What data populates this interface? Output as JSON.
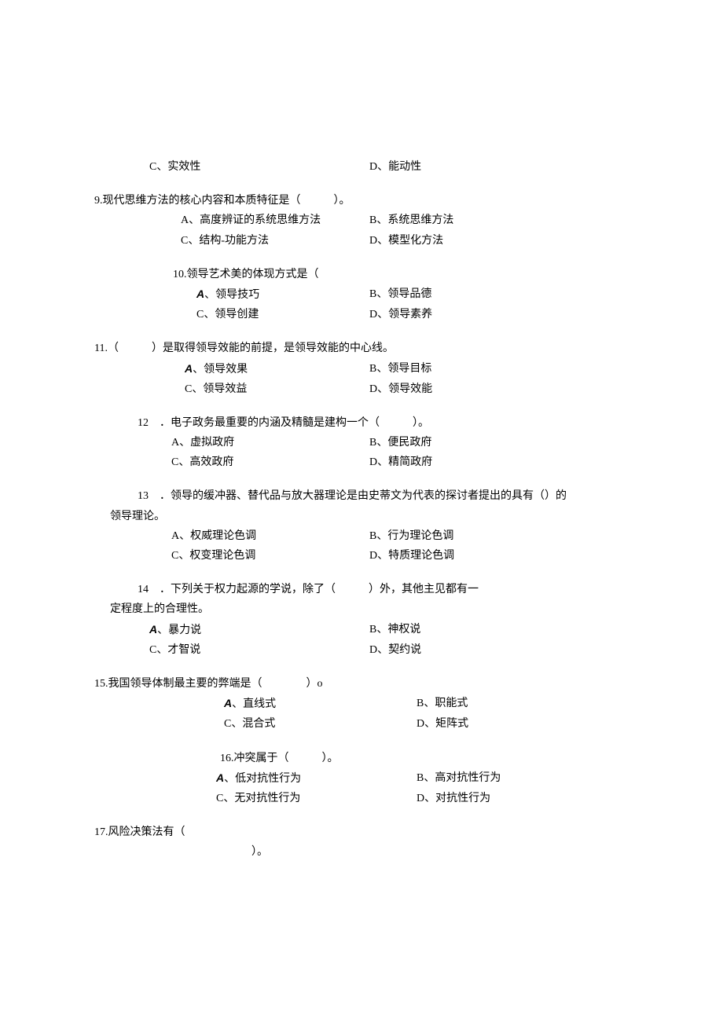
{
  "q8": {
    "c": "C、实效性",
    "d": "D、能动性"
  },
  "q9": {
    "stem": "9.现代思维方法的核心内容和本质特征是（　　　）。",
    "a": "A、高度辨证的系统思维方法",
    "b": "B、系统思维方法",
    "c": "C、结构-功能方法",
    "d": "D、模型化方法"
  },
  "q10": {
    "stem": "10.领导艺术美的体现方式是（",
    "a_prefix": "A",
    "a_text": "、领导技巧",
    "b": "B、领导品德",
    "c": "C、领导创建",
    "d": "D、领导素养"
  },
  "q11": {
    "stem": "11.（　　　）是取得领导效能的前提，是领导效能的中心线。",
    "a_prefix": "A",
    "a_text": "、领导效果",
    "b": "B、领导目标",
    "c": "C、领导效益",
    "d": "D、领导效能"
  },
  "q12": {
    "stem": "12　．电子政务最重要的内涵及精髓是建构一个（　　　）。",
    "a": "A、虚拟政府",
    "b": "B、便民政府",
    "c": "C、高效政府",
    "d": "D、精简政府"
  },
  "q13": {
    "stem": "13　．领导的缓冲器、替代品与放大器理论是由史蒂文为代表的探讨者提出的具有（）的",
    "cont": "领导理论。",
    "a": "A、权威理论色调",
    "b": "B、行为理论色调",
    "c": "C、权变理论色调",
    "d": "D、特质理论色调"
  },
  "q14": {
    "stem": "14　．下列关于权力起源的学说，除了（　　　）外，其他主见都有一",
    "cont": "定程度上的合理性。",
    "a_prefix": "A",
    "a_text": "、暴力说",
    "b": "B、神权说",
    "c": "C、才智说",
    "d": "D、契约说"
  },
  "q15": {
    "stem": "15.我国领导体制最主要的弊端是（　　　　）o",
    "a_prefix": "A",
    "a_text": "、直线式",
    "b": "B、职能式",
    "c": "C、混合式",
    "d": "D、矩阵式"
  },
  "q16": {
    "stem": "16.冲突属于（　　　）。",
    "a_prefix": "A",
    "a_text": "、低对抗性行为",
    "b": "B、高对抗性行为",
    "c": "C、无对抗性行为",
    "d": "D、对抗性行为"
  },
  "q17": {
    "stem": "17.风险决策法有（",
    "cont": "）。"
  }
}
